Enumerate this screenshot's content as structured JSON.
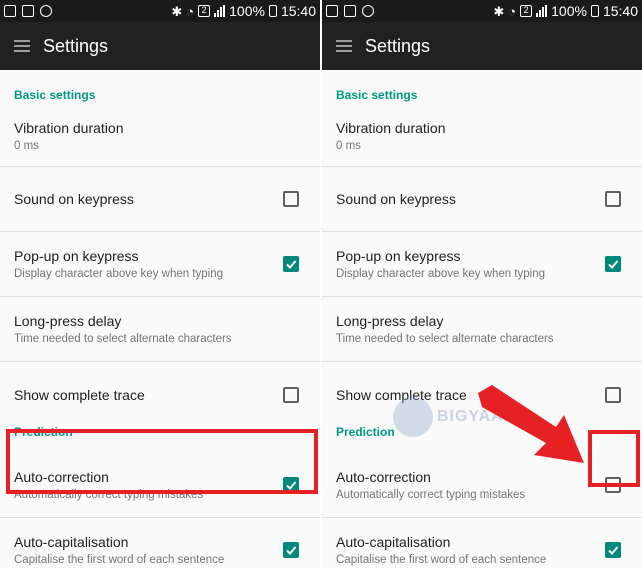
{
  "status_bar": {
    "battery_text": "100%",
    "time": "15:40",
    "sim_label": "2"
  },
  "app_bar": {
    "title": "Settings"
  },
  "colors": {
    "accent": "#009688",
    "checkbox_checked": "#00897b",
    "highlight": "#e52124",
    "app_bar": "#212121"
  },
  "watermark": {
    "text": "BIGYAAN"
  },
  "panels": [
    {
      "sections": [
        {
          "header": "Basic settings",
          "items": [
            {
              "title": "Vibration duration",
              "summary": "0 ms"
            },
            {
              "title": "Sound on keypress",
              "summary": "",
              "checked": false
            },
            {
              "title": "Pop-up on keypress",
              "summary": "Display character above key when typing",
              "checked": true
            },
            {
              "title": "Long-press delay",
              "summary": "Time needed to select alternate characters"
            },
            {
              "title": "Show complete trace",
              "summary": "",
              "checked": false
            }
          ]
        },
        {
          "header": "Prediction",
          "items": [
            {
              "title": "Auto-correction",
              "summary": "Automatically correct typing mistakes",
              "checked": true
            },
            {
              "title": "Auto-capitalisation",
              "summary": "Capitalise the first word of each sentence",
              "checked": true
            }
          ]
        }
      ]
    },
    {
      "sections": [
        {
          "header": "Basic settings",
          "items": [
            {
              "title": "Vibration duration",
              "summary": "0 ms"
            },
            {
              "title": "Sound on keypress",
              "summary": "",
              "checked": false
            },
            {
              "title": "Pop-up on keypress",
              "summary": "Display character above key when typing",
              "checked": true
            },
            {
              "title": "Long-press delay",
              "summary": "Time needed to select alternate characters"
            },
            {
              "title": "Show complete trace",
              "summary": "",
              "checked": false
            }
          ]
        },
        {
          "header": "Prediction",
          "items": [
            {
              "title": "Auto-correction",
              "summary": "Automatically correct typing mistakes",
              "checked": false
            },
            {
              "title": "Auto-capitalisation",
              "summary": "Capitalise the first word of each sentence",
              "checked": true
            }
          ]
        }
      ]
    }
  ]
}
